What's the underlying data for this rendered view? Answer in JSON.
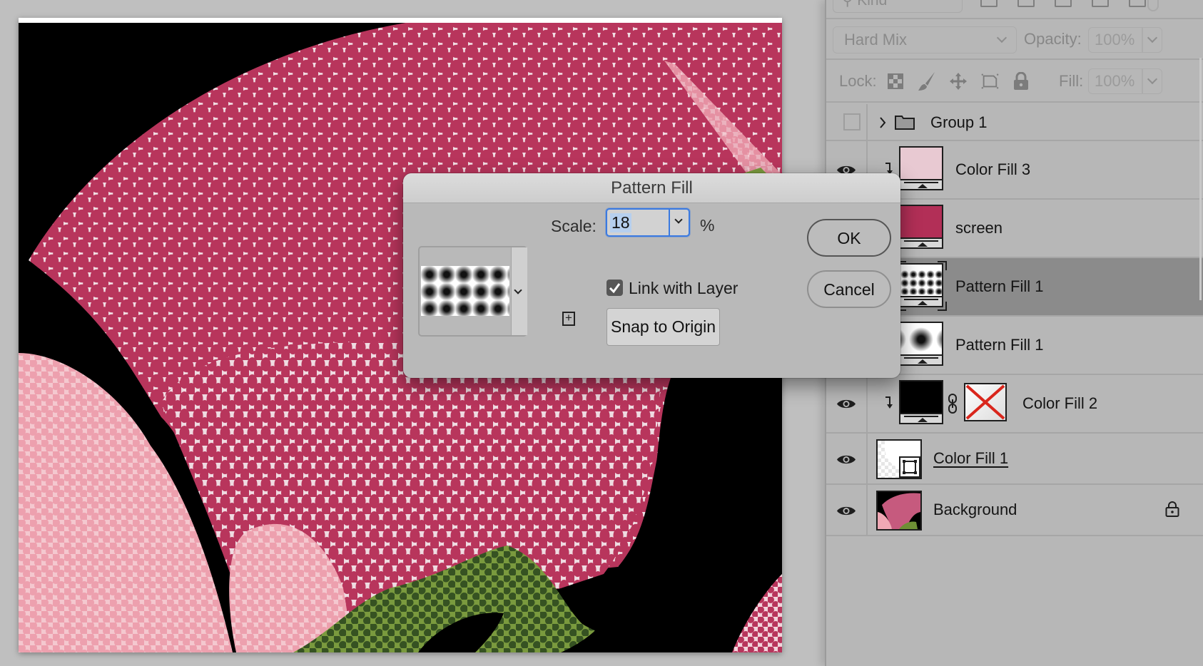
{
  "canvas": {
    "colors": {
      "dark_dot": "#b8355c",
      "light_bg": "#f1dfe4",
      "soft_pink": "#eea6b3",
      "soft_pink_bg": "#f3c3cb",
      "green_bg": "#7a9a3e",
      "green_dot": "#365222",
      "black": "#000000"
    }
  },
  "layers_panel": {
    "filter_kind_label": "Kind",
    "blend_mode": "Hard Mix",
    "opacity_label": "Opacity:",
    "opacity_value": "100%",
    "lock_label": "Lock:",
    "fill_label": "Fill:",
    "fill_value": "100%",
    "layers": [
      {
        "name": "Group 1",
        "type": "group",
        "visible": false,
        "clipped": false,
        "thumbnail": "folder-icon"
      },
      {
        "name": "Color Fill 3",
        "type": "color-fill",
        "visible": true,
        "clipped": true,
        "thumb_color": "#e8c9d2"
      },
      {
        "name": "screen",
        "type": "color-fill",
        "visible": true,
        "clipped": true,
        "thumb_color": "#b22f57"
      },
      {
        "name": "Pattern Fill 1",
        "type": "pattern-fill",
        "visible": true,
        "clipped": true,
        "selected": true
      },
      {
        "name": "Pattern Fill 1",
        "type": "pattern-fill",
        "visible": true,
        "clipped": true
      },
      {
        "name": "Color Fill 2",
        "type": "color-fill",
        "visible": true,
        "clipped": true,
        "thumb_color": "#000000",
        "has_mask": true,
        "mask_disabled": true
      },
      {
        "name": "Color Fill 1",
        "type": "color-fill",
        "visible": true,
        "clipped": false,
        "underlined": true,
        "smart_object": true
      },
      {
        "name": "Background",
        "type": "background",
        "visible": true,
        "locked": true
      }
    ]
  },
  "dialog": {
    "title": "Pattern Fill",
    "scale_label": "Scale:",
    "scale_value": "18",
    "scale_unit": "%",
    "link_with_layer_label": "Link with Layer",
    "link_with_layer_checked": true,
    "snap_to_origin_label": "Snap to Origin",
    "ok_label": "OK",
    "cancel_label": "Cancel",
    "accent_color": "#3b7ae0"
  }
}
